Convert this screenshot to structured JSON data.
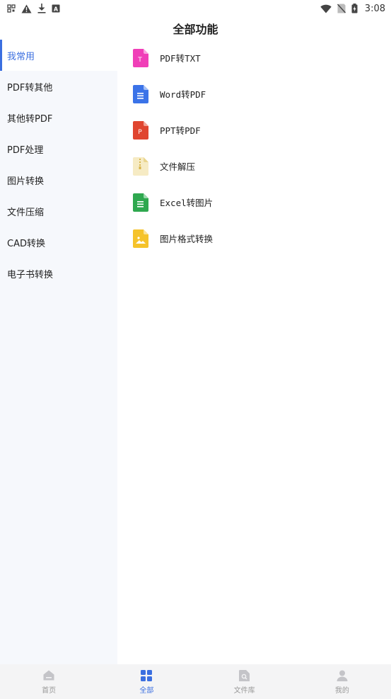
{
  "status_bar": {
    "time": "3:08",
    "left_icons": [
      "qr-scan-icon",
      "warning-icon",
      "download-icon",
      "app-a-icon"
    ],
    "right_icons": [
      "wifi-icon",
      "no-sim-icon",
      "battery-icon"
    ]
  },
  "header": {
    "title": "全部功能"
  },
  "sidebar": {
    "items": [
      {
        "label": "我常用",
        "active": true
      },
      {
        "label": "PDF转其他",
        "active": false
      },
      {
        "label": "其他转PDF",
        "active": false
      },
      {
        "label": "PDF处理",
        "active": false
      },
      {
        "label": "图片转换",
        "active": false
      },
      {
        "label": "文件压缩",
        "active": false
      },
      {
        "label": "CAD转换",
        "active": false
      },
      {
        "label": "电子书转换",
        "active": false
      }
    ]
  },
  "functions": [
    {
      "label": "PDF转TXT",
      "icon": "txt-file-icon",
      "color": "#f03fb8",
      "glyph": "T"
    },
    {
      "label": "Word转PDF",
      "icon": "word-file-icon",
      "color": "#3b73e8",
      "glyph": "lines"
    },
    {
      "label": "PPT转PDF",
      "icon": "ppt-file-icon",
      "color": "#e0452f",
      "glyph": "P"
    },
    {
      "label": "文件解压",
      "icon": "zip-file-icon",
      "color": "#f6ebc4",
      "glyph": "zip"
    },
    {
      "label": "Excel转图片",
      "icon": "excel-file-icon",
      "color": "#2fa84f",
      "glyph": "lines"
    },
    {
      "label": "图片格式转换",
      "icon": "image-file-icon",
      "color": "#f5c32b",
      "glyph": "image"
    }
  ],
  "bottom_nav": {
    "items": [
      {
        "label": "首页",
        "icon": "home-icon",
        "active": false
      },
      {
        "label": "全部",
        "icon": "grid-icon",
        "active": true
      },
      {
        "label": "文件库",
        "icon": "file-library-icon",
        "active": false
      },
      {
        "label": "我的",
        "icon": "profile-icon",
        "active": false
      }
    ]
  },
  "colors": {
    "accent": "#3b6fe0",
    "sidebar_bg": "#f6f8fc",
    "nav_bg": "#f4f4f5",
    "nav_inactive": "#999999"
  }
}
